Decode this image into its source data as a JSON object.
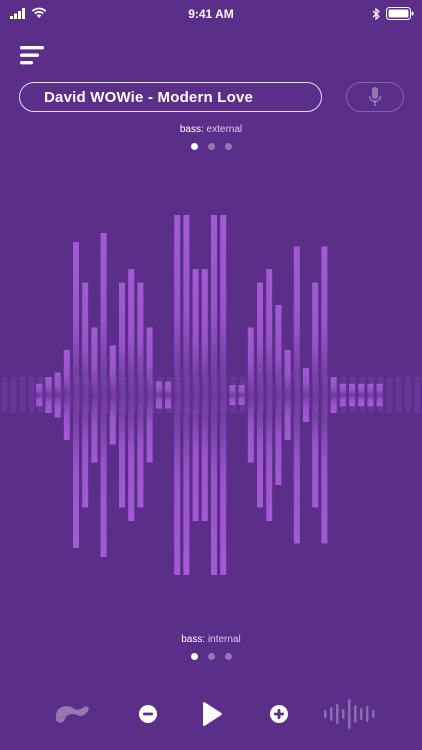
{
  "status": {
    "time": "9:41 AM"
  },
  "track": {
    "title": "David WOWie - Modern Love"
  },
  "modes": {
    "top": {
      "prefix": "bass:",
      "value": "external"
    },
    "bottom": {
      "prefix": "bass:",
      "value": "internal"
    },
    "page_count": 3,
    "active_index": 0
  },
  "colors": {
    "background": "#5b2e8a",
    "bar": "#a45ad6",
    "text": "#ffffff"
  },
  "equalizer": {
    "levels": [
      0.05,
      0.08,
      0.1,
      0.2,
      0.68,
      0.5,
      0.3,
      0.72,
      0.22,
      0.5,
      0.56,
      0.5,
      0.3,
      0.06,
      0.06,
      0.8,
      0.8,
      0.56,
      0.56,
      0.8,
      0.8,
      0.04,
      0.04,
      0.3,
      0.5,
      0.56,
      0.4,
      0.2,
      0.66,
      0.12,
      0.5,
      0.66,
      0.08,
      0.05,
      0.05,
      0.05,
      0.05,
      0.05
    ]
  },
  "icons": {
    "menu": "hamburger-icon",
    "mic": "microphone-icon",
    "device": "toy-device-icon",
    "decrease": "minus-circle-icon",
    "play": "play-icon",
    "increase": "plus-circle-icon",
    "waveform": "waveform-icon"
  }
}
